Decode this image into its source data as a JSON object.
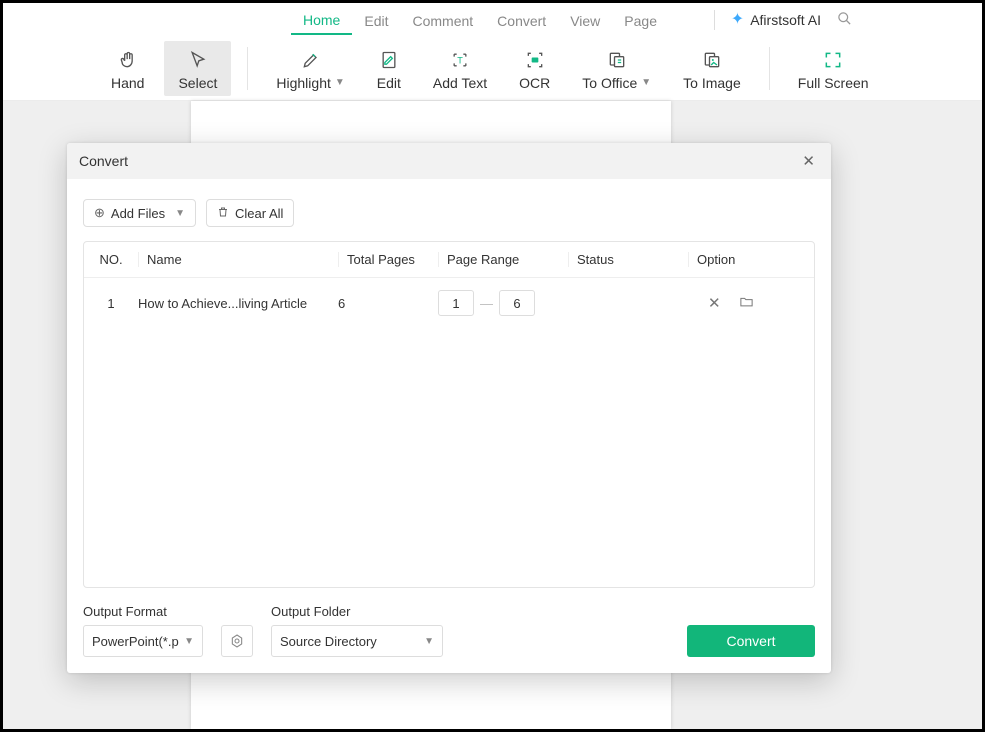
{
  "menu": {
    "items": [
      "Home",
      "Edit",
      "Comment",
      "Convert",
      "View",
      "Page"
    ],
    "active_index": 0,
    "ai_label": "Afirstsoft AI"
  },
  "toolbar": {
    "hand": "Hand",
    "select": "Select",
    "highlight": "Highlight",
    "edit": "Edit",
    "add_text": "Add Text",
    "ocr": "OCR",
    "to_office": "To Office",
    "to_image": "To Image",
    "full_screen": "Full Screen"
  },
  "dialog": {
    "title": "Convert",
    "add_files": "Add Files",
    "clear_all": "Clear All",
    "columns": {
      "no": "NO.",
      "name": "Name",
      "total_pages": "Total Pages",
      "page_range": "Page Range",
      "status": "Status",
      "option": "Option"
    },
    "rows": [
      {
        "no": "1",
        "name": "How to Achieve...living Article",
        "total_pages": "6",
        "range_from": "1",
        "range_to": "6",
        "status": ""
      }
    ],
    "output_format_label": "Output Format",
    "output_format_value": "PowerPoint(*.p",
    "output_folder_label": "Output Folder",
    "output_folder_value": "Source Directory",
    "convert_button": "Convert"
  }
}
